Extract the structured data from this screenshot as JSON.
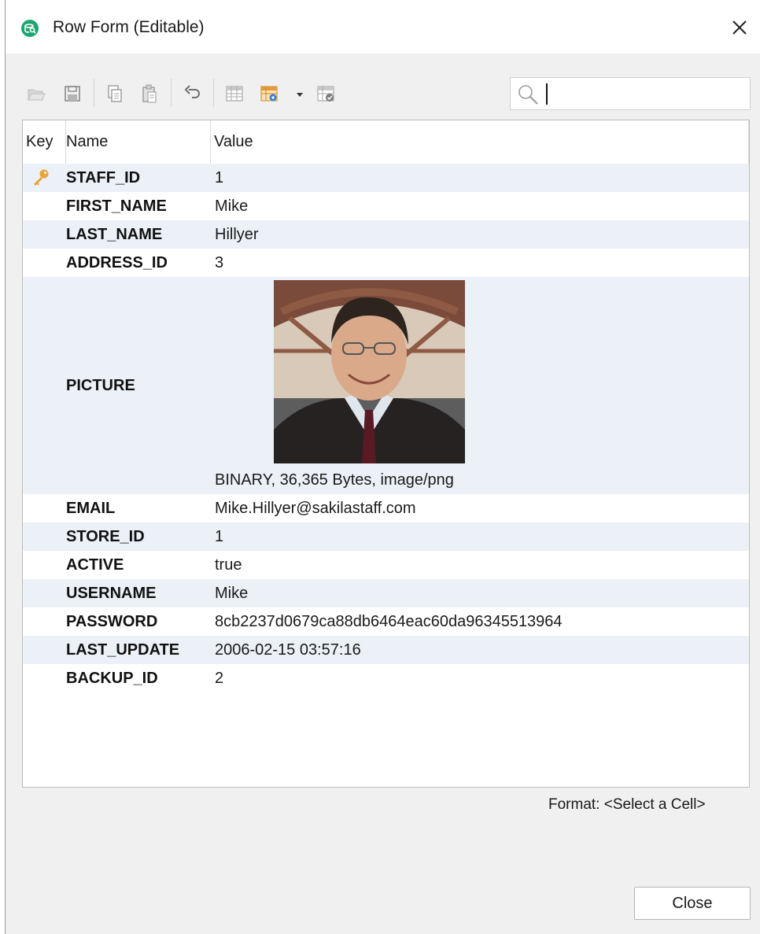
{
  "window": {
    "title": "Row Form (Editable)"
  },
  "toolbar": {
    "icons": [
      "open-folder-icon",
      "save-icon",
      "copy-icon",
      "paste-icon",
      "undo-icon",
      "grid-view-icon",
      "grid-settings-icon",
      "dropdown-arrow-icon",
      "grid-check-icon"
    ],
    "search_value": ""
  },
  "grid": {
    "columns": {
      "key": "Key",
      "name": "Name",
      "value": "Value"
    },
    "rows": [
      {
        "name": "STAFF_ID",
        "value": "1",
        "key": true
      },
      {
        "name": "FIRST_NAME",
        "value": "Mike"
      },
      {
        "name": "LAST_NAME",
        "value": "Hillyer"
      },
      {
        "name": "ADDRESS_ID",
        "value": "3"
      },
      {
        "name": "PICTURE",
        "value": "BINARY, 36,365 Bytes, image/png"
      },
      {
        "name": "EMAIL",
        "value": "Mike.Hillyer@sakilastaff.com"
      },
      {
        "name": "STORE_ID",
        "value": "1"
      },
      {
        "name": "ACTIVE",
        "value": "true"
      },
      {
        "name": "USERNAME",
        "value": "Mike"
      },
      {
        "name": "PASSWORD",
        "value": "8cb2237d0679ca88db6464eac60da96345513964"
      },
      {
        "name": "LAST_UPDATE",
        "value": "2006-02-15 03:57:16"
      },
      {
        "name": "BACKUP_ID",
        "value": "2"
      }
    ]
  },
  "status": {
    "format": "Format: <Select a Cell>"
  },
  "footer": {
    "close_label": "Close"
  },
  "colors": {
    "row_alt": "#ebf1f7",
    "app_icon": "#1ea672",
    "key_icon": "#e8a33a"
  }
}
